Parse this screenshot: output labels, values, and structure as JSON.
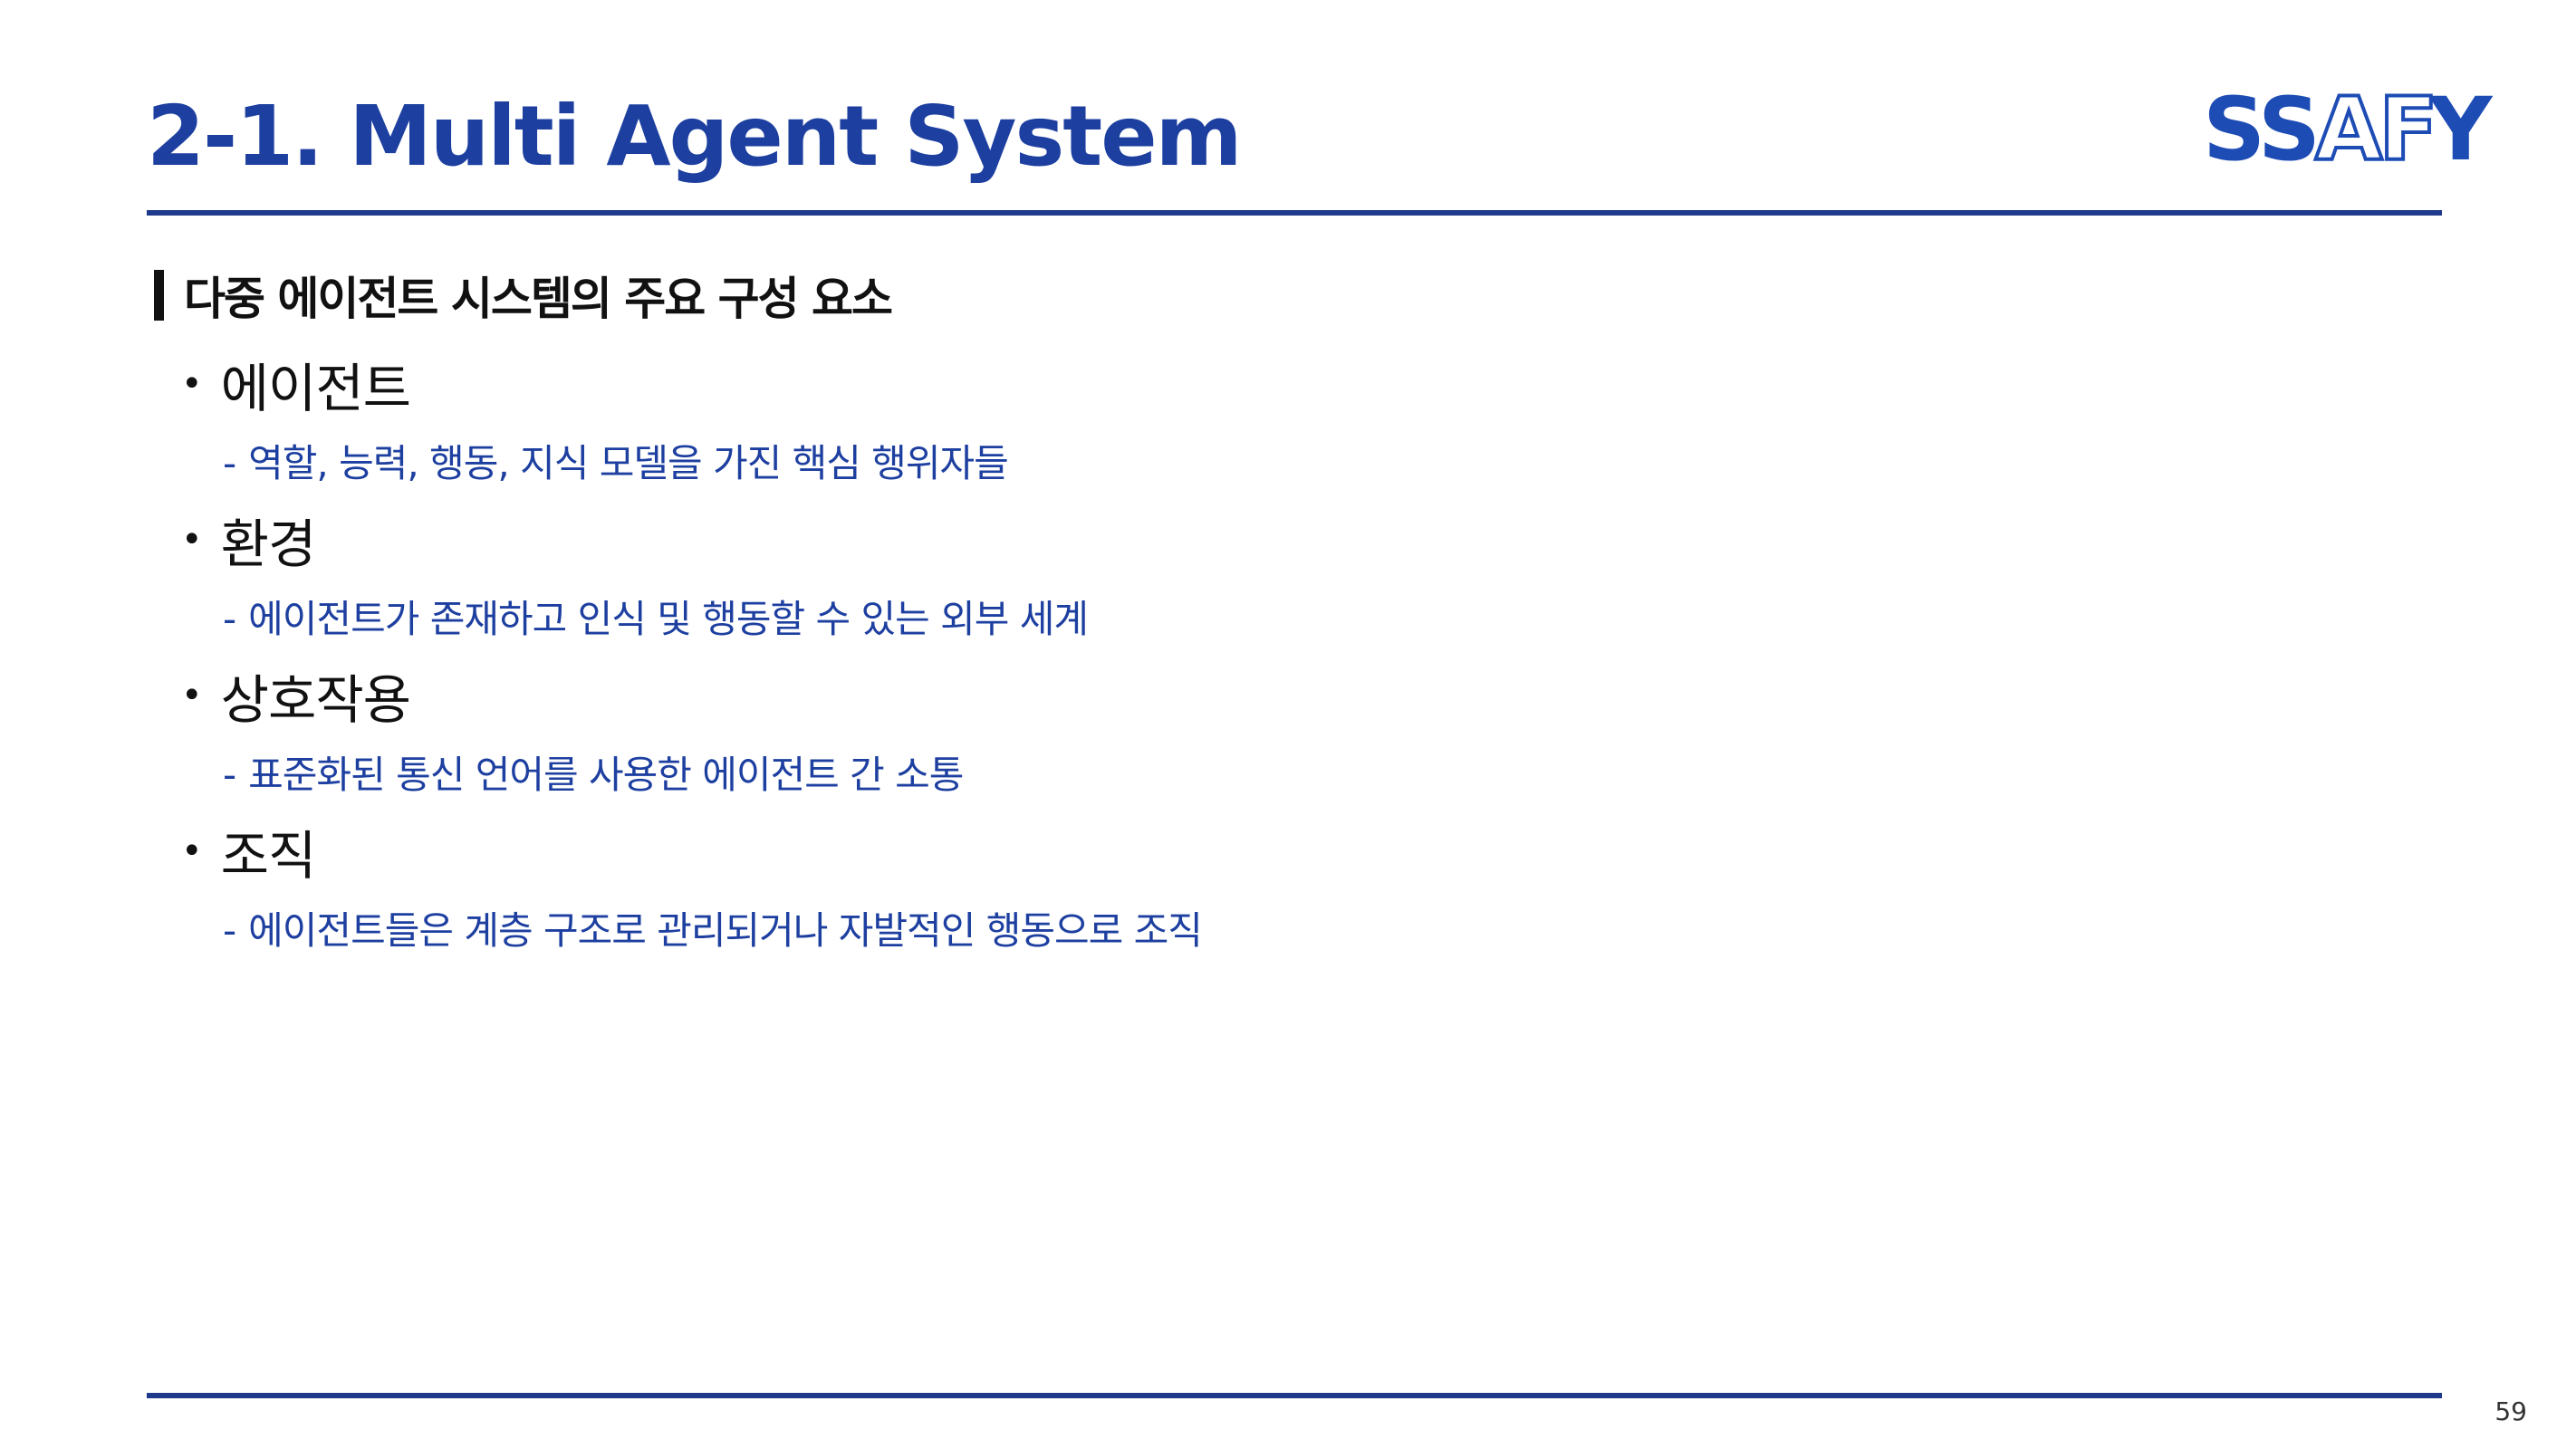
{
  "slide": {
    "title": "2-1. Multi Agent System",
    "logo_text": "SSAFY",
    "section_heading": "다중 에이전트 시스템의 주요 구성 요소",
    "items": [
      {
        "label": "에이전트",
        "description": "역할, 능력, 행동, 지식 모델을 가진 핵심 행위자들"
      },
      {
        "label": "환경",
        "description": "에이전트가 존재하고 인식 및 행동할 수 있는 외부 세계"
      },
      {
        "label": "상호작용",
        "description": "표준화된 통신 언어를 사용한 에이전트 간 소통"
      },
      {
        "label": "조직",
        "description": "에이전트들은 계층 구조로 관리되거나 자발적인 행동으로 조직"
      }
    ],
    "bullet_symbol": "•",
    "dash_symbol": "-",
    "page_number": "59"
  },
  "colors": {
    "title": "#1d3fa0",
    "rule": "#1f3a8a",
    "description": "#1d3fa0",
    "logo": "#1e4cb5"
  }
}
